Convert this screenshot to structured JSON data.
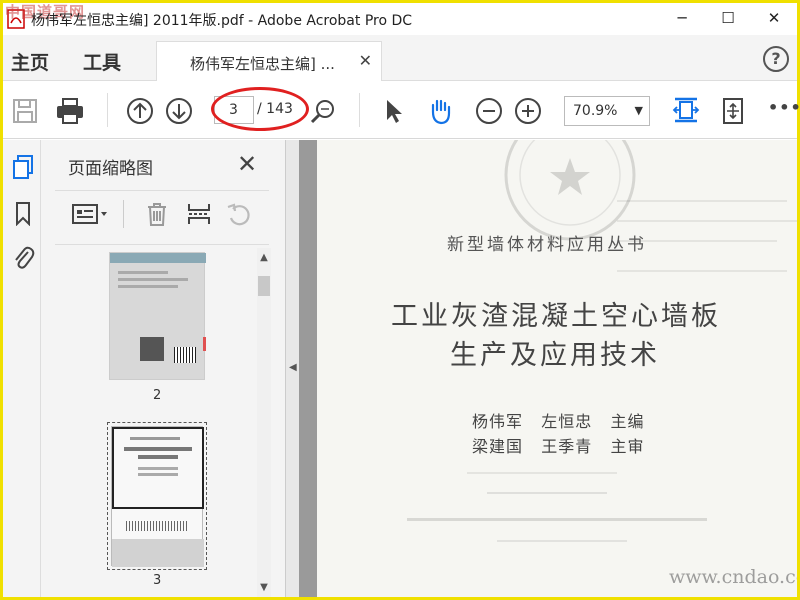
{
  "watermark_top": "中国道哥网",
  "window": {
    "title": "杨伟军左恒忠主编] 2011年版.pdf - Adobe Acrobat Pro DC",
    "minimize": "─",
    "maximize": "☐",
    "close": "✕"
  },
  "tabs": {
    "home": "主页",
    "tools": "工具",
    "document": "杨伟军左恒忠主编] ...",
    "document_close": "✕",
    "help": "?"
  },
  "toolbar": {
    "current_page": "3",
    "total_pages": "/ 143",
    "zoom": "70.9%",
    "more": "•••",
    "annotation_color": "#e02020"
  },
  "thumbnail_panel": {
    "title": "页面缩略图",
    "close": "✕",
    "thumbnails": [
      {
        "page_number": "2"
      },
      {
        "page_number": "3"
      }
    ]
  },
  "document": {
    "series": "新型墙体材料应用丛书",
    "book_title_line1": "工业灰渣混凝土空心墙板",
    "book_title_line2": "生产及应用技术",
    "authors_line1": "杨伟军   左恒忠   主编",
    "authors_line2": "梁建国   王季青   主审",
    "watermark": "www.cndao.com"
  },
  "colors": {
    "accent_blue": "#1473e6",
    "frame_yellow": "#f0e000"
  }
}
